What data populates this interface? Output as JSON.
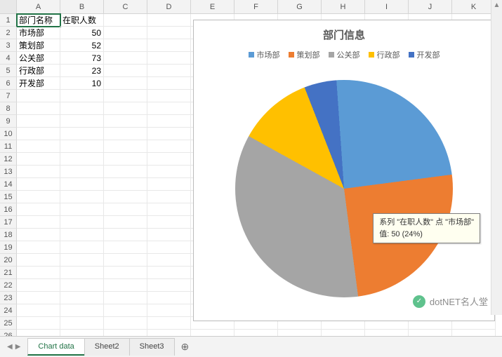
{
  "columns": [
    "A",
    "B",
    "C",
    "D",
    "E",
    "F",
    "G",
    "H",
    "I",
    "J",
    "K"
  ],
  "table": {
    "headers": [
      "部门名称",
      "在职人数"
    ],
    "rows": [
      {
        "name": "市场部",
        "count": 50
      },
      {
        "name": "策划部",
        "count": 52
      },
      {
        "name": "公关部",
        "count": 73
      },
      {
        "name": "行政部",
        "count": 23
      },
      {
        "name": "开发部",
        "count": 10
      }
    ]
  },
  "chart_data": {
    "type": "pie",
    "title": "部门信息",
    "categories": [
      "市场部",
      "策划部",
      "公关部",
      "行政部",
      "开发部"
    ],
    "values": [
      50,
      52,
      73,
      23,
      10
    ],
    "colors": [
      "#5b9bd5",
      "#ed7d31",
      "#a5a5a5",
      "#ffc000",
      "#4472c4"
    ],
    "series_name": "在职人数",
    "legend_position": "top"
  },
  "tooltip": {
    "line1": "系列 \"在职人数\" 点 \"市场部\"",
    "line2": "值: 50 (24%)"
  },
  "sheets": {
    "tabs": [
      "Chart data",
      "Sheet2",
      "Sheet3"
    ],
    "active": 0,
    "add_label": "⊕"
  },
  "watermark": "dotNET名人堂",
  "selected_cell": "A1"
}
